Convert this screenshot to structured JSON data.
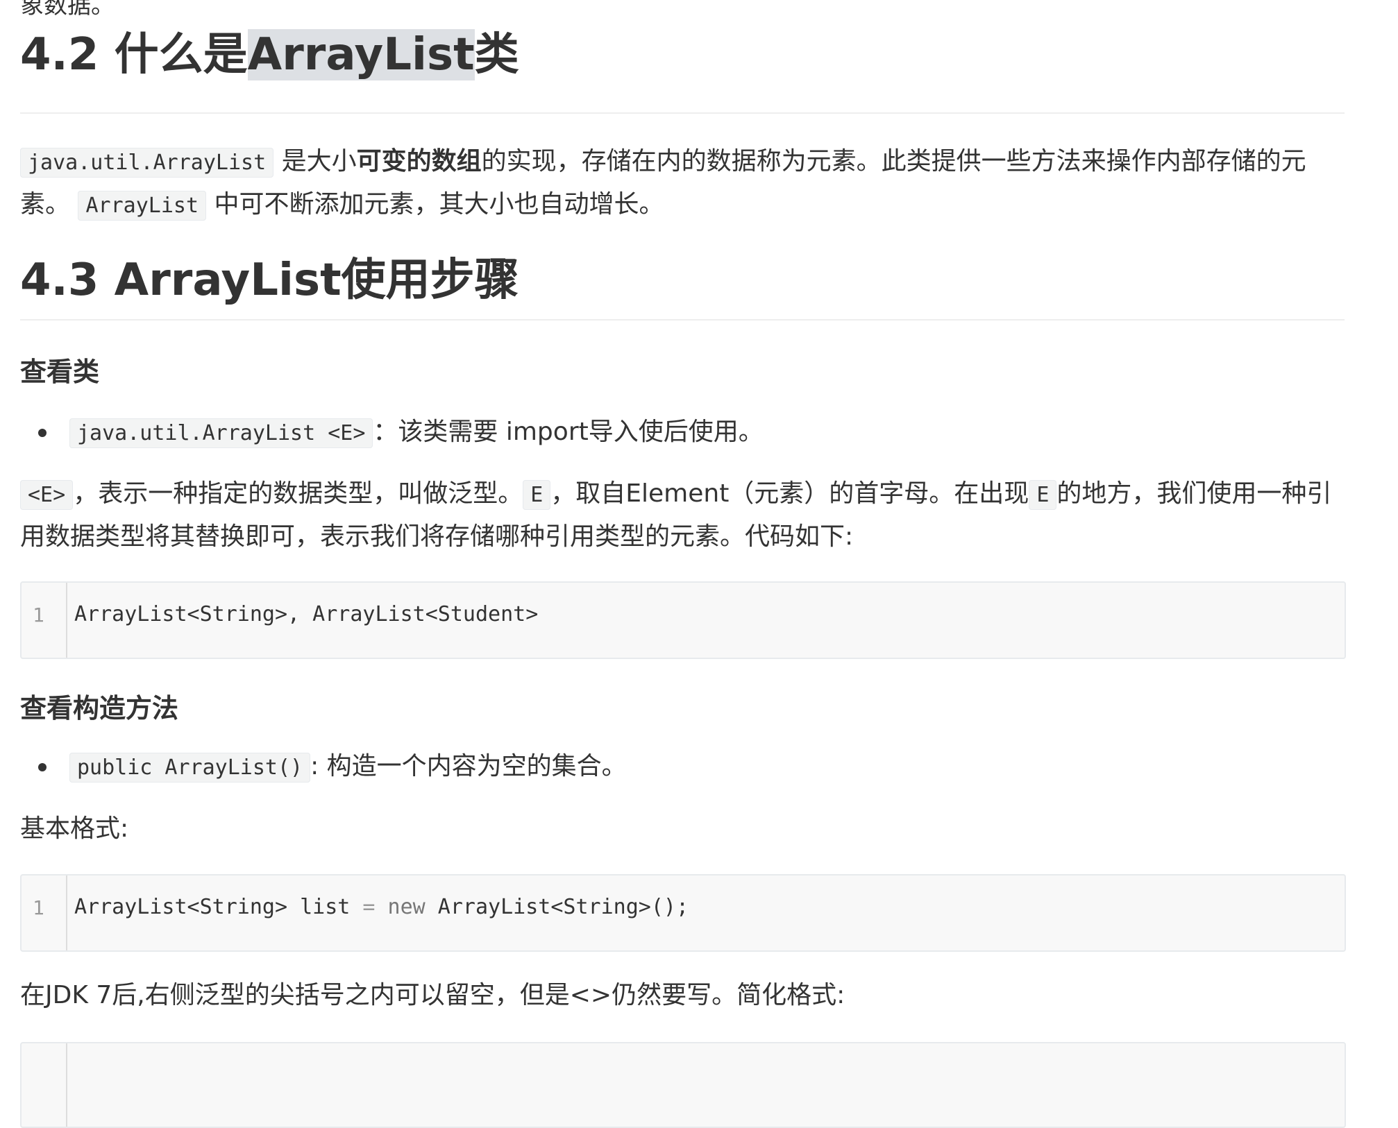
{
  "top_fragment": "象数据。",
  "section_42": {
    "title_prefix": "4.2 什么是",
    "title_highlight": "ArrayList",
    "title_suffix": "类",
    "code1": "java.util.ArrayList",
    "text1": " 是大小",
    "bold": "可变的数组",
    "text2": "的实现，存储在内的数据称为元素。此类提供一些方法来操作内部存储的元素。 ",
    "code2": "ArrayList",
    "text3": " 中可不断添加元素，其大小也自动增长。"
  },
  "section_43": {
    "title": "4.3 ArrayList使用步骤",
    "view_class": {
      "heading": "查看类",
      "bullet_code": "java.util.ArrayList <E>",
      "bullet_text": "：该类需要 import导入使后使用。",
      "para": {
        "code_E_generic": "<E>",
        "t1": "，表示一种指定的数据类型，叫做泛型。",
        "code_E": "E",
        "t2": "，取自Element（元素）的首字母。在出现",
        "code_E2": "E",
        "t3": "的地方，我们使用一种引用数据类型将其替换即可，表示我们将存储哪种引用类型的元素。代码如下:"
      },
      "codeblock": {
        "line_number": "1",
        "code": "ArrayList<String>, ArrayList<Student>"
      }
    },
    "view_constructor": {
      "heading": "查看构造方法",
      "bullet_code": "public ArrayList()",
      "bullet_text": ": 构造一个内容为空的集合。",
      "basic_format_label": "基本格式:",
      "codeblock": {
        "line_number": "1",
        "code_part1": "ArrayList<String> list ",
        "code_eq": "=",
        "code_new": " new ",
        "code_part2": "ArrayList<String>();"
      },
      "jdk_note": "在JDK 7后,右侧泛型的尖括号之内可以留空，但是<>仍然要写。简化格式:"
    }
  }
}
